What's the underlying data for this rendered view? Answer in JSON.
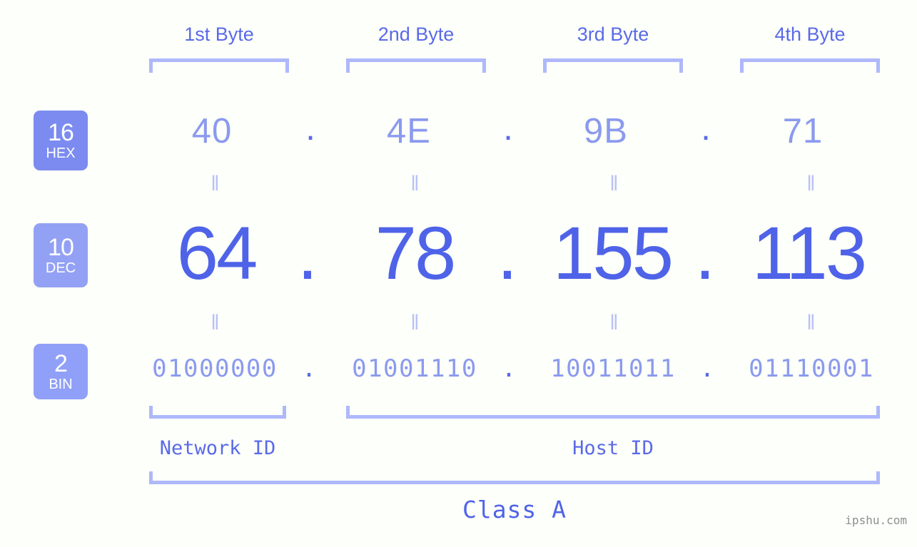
{
  "page": {
    "ip_address": "64.78.155.113",
    "ip_class": "Class A",
    "watermark": "ipshu.com",
    "background_color": "#fdfffa",
    "accent_light": "#8b9aee",
    "accent_strong": "#4f63e8",
    "bracket_color": "#aeb8fb"
  },
  "byte_headers": [
    {
      "label": "1st Byte"
    },
    {
      "label": "2nd Byte"
    },
    {
      "label": "3rd Byte"
    },
    {
      "label": "4th Byte"
    }
  ],
  "base_badges": [
    {
      "number": "16",
      "abbr": "HEX",
      "color": "#7b8bf0"
    },
    {
      "number": "10",
      "abbr": "DEC",
      "color": "#93a1f4"
    },
    {
      "number": "2",
      "abbr": "BIN",
      "color": "#90a0f8"
    }
  ],
  "rows": {
    "hex": {
      "values": [
        "40",
        "4E",
        "9B",
        "71"
      ],
      "separator": "."
    },
    "dec": {
      "values": [
        "64",
        "78",
        "155",
        "113"
      ],
      "separator": "."
    },
    "bin": {
      "values": [
        "01000000",
        "01001110",
        "10011011",
        "01110001"
      ],
      "separator": "."
    }
  },
  "equality_marks": {
    "symbol": "‖"
  },
  "sections": {
    "network_id": "Network ID",
    "host_id": "Host ID",
    "class": "Class A"
  }
}
